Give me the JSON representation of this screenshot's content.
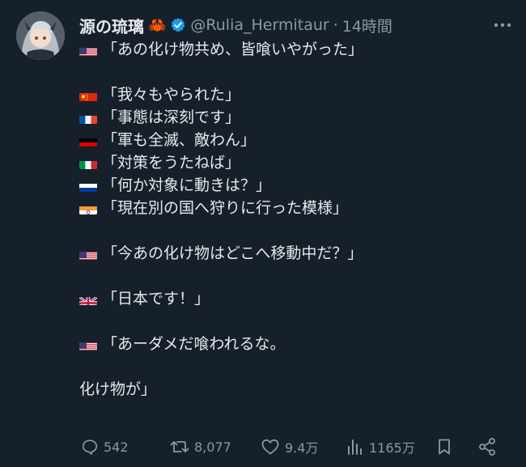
{
  "author": {
    "name": "源の琉璃",
    "emoji": "🦀",
    "handle": "@Rulia_Hermitaur",
    "separator": "·",
    "time": "14時間"
  },
  "content": {
    "lines": [
      {
        "flag": "us",
        "text": "「あの化け物共め、皆喰いやがった」"
      },
      {
        "flag": "",
        "text": ""
      },
      {
        "flag": "cn",
        "text": "「我々もやられた」"
      },
      {
        "flag": "fr",
        "text": "「事態は深刻です」"
      },
      {
        "flag": "de",
        "text": "「軍も全滅、敵わん」"
      },
      {
        "flag": "it",
        "text": "「対策をうたねば」"
      },
      {
        "flag": "ru",
        "text": "「何か対象に動きは？」"
      },
      {
        "flag": "in",
        "text": "「現在別の国へ狩りに行った模様」"
      },
      {
        "flag": "",
        "text": ""
      },
      {
        "flag": "us",
        "text": "「今あの化け物はどこへ移動中だ？」"
      },
      {
        "flag": "",
        "text": ""
      },
      {
        "flag": "gb",
        "text": "「日本です！」"
      },
      {
        "flag": "",
        "text": ""
      },
      {
        "flag": "us",
        "text": "「あーダメだ喰われるな。"
      },
      {
        "flag": "",
        "text": ""
      },
      {
        "flag": "",
        "text": "化け物が」"
      }
    ]
  },
  "actions": {
    "replies": "542",
    "retweets": "8,077",
    "likes": "9.4万",
    "views": "1165万"
  },
  "colors": {
    "background": "#15202b",
    "text": "#e7e9ea",
    "muted": "#8b98a5",
    "verified": "#1d9bf0"
  }
}
